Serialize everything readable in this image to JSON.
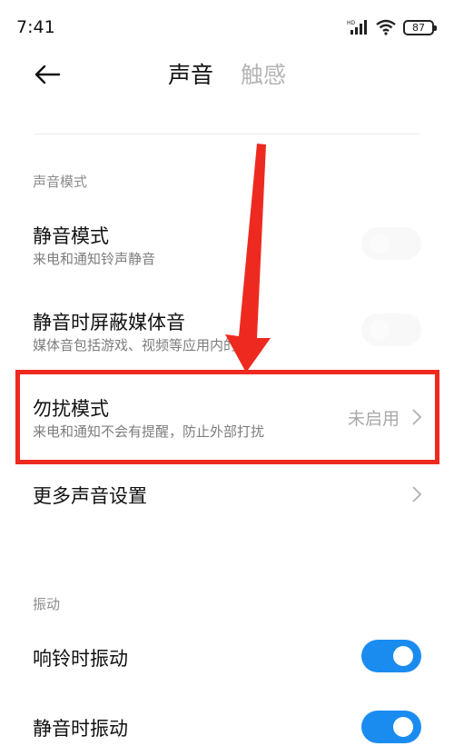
{
  "status_bar": {
    "time": "7:41",
    "battery": "87",
    "icons": [
      "hd-signal-icon",
      "wifi-icon",
      "battery-icon"
    ]
  },
  "header": {
    "back_icon": "arrow-left-icon",
    "tabs": [
      {
        "label": "声音",
        "active": true
      },
      {
        "label": "触感",
        "active": false
      }
    ]
  },
  "sections": {
    "sound_mode": {
      "label": "声音模式",
      "items": [
        {
          "title": "静音模式",
          "subtitle": "来电和通知铃声静音",
          "toggle": false
        },
        {
          "title": "静音时屏蔽媒体音",
          "subtitle": "媒体音包括游戏、视频等应用内的声音",
          "toggle": false
        },
        {
          "title": "勿扰模式",
          "subtitle": "来电和通知不会有提醒，防止外部打扰",
          "value": "未启用",
          "chevron": true
        },
        {
          "title": "更多声音设置",
          "chevron": true
        }
      ]
    },
    "vibration": {
      "label": "振动",
      "items": [
        {
          "title": "响铃时振动",
          "toggle": true
        },
        {
          "title": "静音时振动",
          "toggle": true
        }
      ]
    }
  },
  "colors": {
    "accent": "#1a8cf0",
    "annotation": "#ee2a20",
    "inactive_tab": "#b5b5b5"
  }
}
